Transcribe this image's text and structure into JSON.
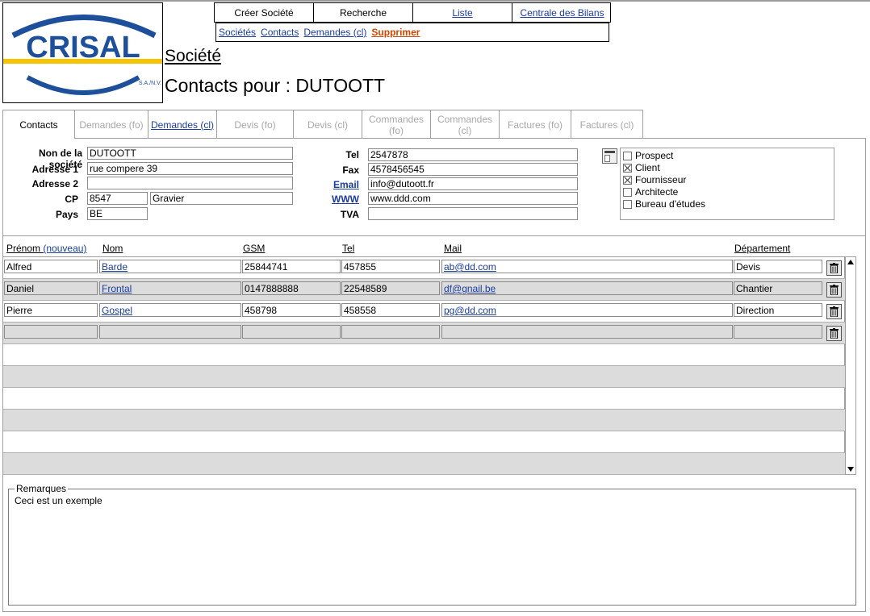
{
  "logo": {
    "text": "CRISAL",
    "subtext": "S.A./N.V.",
    "blue": "#1e4f9a",
    "yellow": "#f5c400"
  },
  "menu": {
    "items": [
      {
        "label": "Créer Société",
        "width": 123,
        "link": false
      },
      {
        "label": "Recherche",
        "width": 123,
        "link": false
      },
      {
        "label": "Liste",
        "width": 123,
        "link": true
      },
      {
        "label": "Centrale des Bilans",
        "width": 123,
        "link": true
      }
    ],
    "sub": [
      {
        "label": "Sociétés"
      },
      {
        "label": "Contacts"
      },
      {
        "label": "Demandes (cl)"
      },
      {
        "label": "Supprimer"
      }
    ]
  },
  "header": {
    "title": "Société",
    "subtitle": "Contacts pour : DUTOOTT"
  },
  "tabs": [
    {
      "label": "Contacts",
      "line2": ""
    },
    {
      "label": "Demandes (fo)",
      "line2": ""
    },
    {
      "label": "Demandes (cl)",
      "line2": ""
    },
    {
      "label": "Devis (fo)",
      "line2": ""
    },
    {
      "label": "Devis (cl)",
      "line2": ""
    },
    {
      "label": "Commandes",
      "line2": "(fo)"
    },
    {
      "label": "Commandes",
      "line2": "(cl)"
    },
    {
      "label": "Factures (fo)",
      "line2": ""
    },
    {
      "label": "Factures (cl)",
      "line2": ""
    }
  ],
  "company": {
    "name_label": "Non de la société",
    "name": "DUTOOTT",
    "addr1_label": "Adresse 1",
    "addr1": "rue compere 39",
    "addr2_label": "Adresse 2",
    "addr2": "",
    "cp_label": "CP",
    "cp": "8547",
    "city": "Gravier",
    "country_label": "Pays",
    "country": "BE",
    "tel_label": "Tel",
    "tel": "2547878",
    "fax_label": "Fax",
    "fax": "4578456545",
    "email_label": "Email",
    "email": "info@dutoott.fr",
    "www_label": "WWW",
    "www": "www.ddd.com",
    "tva_label": "TVA",
    "tva": ""
  },
  "types": [
    {
      "label": "Prospect",
      "checked": false
    },
    {
      "label": "Client",
      "checked": true
    },
    {
      "label": "Fournisseur",
      "checked": true
    },
    {
      "label": "Architecte",
      "checked": false
    },
    {
      "label": "Bureau d'études",
      "checked": false
    }
  ],
  "grid": {
    "headers": {
      "prenom": "Prénom",
      "nouveau": "(nouveau)",
      "nom": "Nom",
      "gsm": "GSM",
      "tel": "Tel",
      "mail": "Mail",
      "dept": "Département"
    },
    "rows": [
      {
        "prenom": "Alfred",
        "nom": "Barde",
        "gsm": "25844741",
        "tel": "457855",
        "mail": "ab@dd.com",
        "dept": "Devis"
      },
      {
        "prenom": "Daniel",
        "nom": "Frontal",
        "gsm": "0147888888",
        "tel": "22548589",
        "mail": "df@gnail.be",
        "dept": "Chantier"
      },
      {
        "prenom": "Pierre",
        "nom": "Gospel",
        "gsm": "458798",
        "tel": "458558",
        "mail": "pg@dd.com",
        "dept": "Direction"
      },
      {
        "prenom": "",
        "nom": "",
        "gsm": "",
        "tel": "",
        "mail": "",
        "dept": ""
      }
    ]
  },
  "remarks": {
    "legend": "Remarques",
    "text": "Ceci est un exemple"
  }
}
